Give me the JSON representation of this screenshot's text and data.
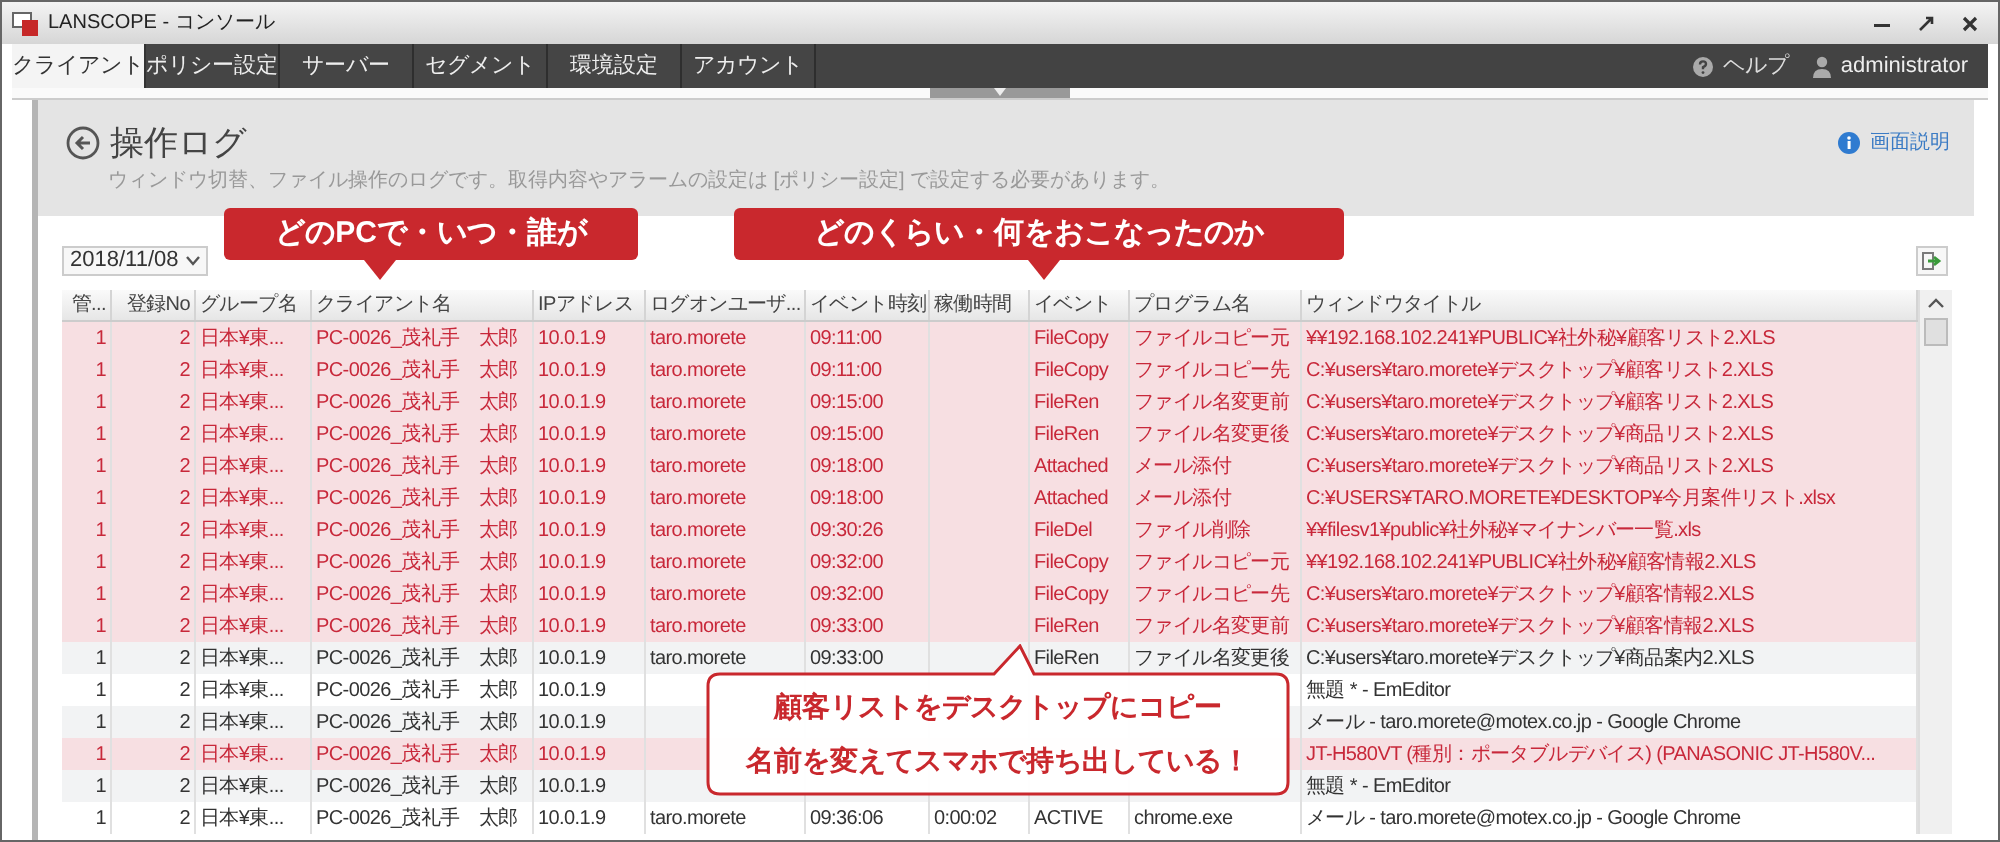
{
  "window": {
    "title": "LANSCOPE - コンソール"
  },
  "tabs": [
    {
      "label": "クライアント",
      "selected": true
    },
    {
      "label": "ポリシー設定",
      "selected": false
    },
    {
      "label": "サーバー",
      "selected": false
    },
    {
      "label": "セグメント",
      "selected": false
    },
    {
      "label": "環境設定",
      "selected": false
    },
    {
      "label": "アカウント",
      "selected": false
    }
  ],
  "header_links": {
    "help": "ヘルプ",
    "user": "administrator"
  },
  "page": {
    "title": "操作ログ",
    "description": "ウィンドウ切替、ファイル操作のログです。取得内容やアラームの設定は [ポリシー設定] で設定する必要があります。",
    "help_link": "画面説明"
  },
  "callouts": [
    {
      "text": "どのPCで・いつ・誰が"
    },
    {
      "text": "どのくらい・何をおこなったのか"
    }
  ],
  "note": {
    "lines": [
      "顧客リストをデスクトップにコピー",
      "名前を変えてスマホで持ち出している！"
    ]
  },
  "date_filter": {
    "value": "2018/11/08"
  },
  "table": {
    "columns": [
      "管...",
      "登録No",
      "グループ名",
      "クライアント名",
      "IPアドレス",
      "ログオンユーザ...",
      "イベント時刻",
      "稼働時間",
      "イベント",
      "プログラム名",
      "ウィンドウタイトル"
    ],
    "rows": [
      {
        "alarm": true,
        "cells": [
          "1",
          "2",
          "日本¥東...",
          "PC-0026_茂礼手　太郎",
          "10.0.1.9",
          "taro.morete",
          "09:11:00",
          null,
          "FileCopy",
          "ファイルコピー元",
          "¥¥192.168.102.241¥PUBLIC¥社外秘¥顧客リスト2.XLS"
        ]
      },
      {
        "alarm": true,
        "cells": [
          "1",
          "2",
          "日本¥東...",
          "PC-0026_茂礼手　太郎",
          "10.0.1.9",
          "taro.morete",
          "09:11:00",
          null,
          "FileCopy",
          "ファイルコピー先",
          "C:¥users¥taro.morete¥デスクトップ¥顧客リスト2.XLS"
        ]
      },
      {
        "alarm": true,
        "cells": [
          "1",
          "2",
          "日本¥東...",
          "PC-0026_茂礼手　太郎",
          "10.0.1.9",
          "taro.morete",
          "09:15:00",
          null,
          "FileRen",
          "ファイル名変更前",
          "C:¥users¥taro.morete¥デスクトップ¥顧客リスト2.XLS"
        ]
      },
      {
        "alarm": true,
        "cells": [
          "1",
          "2",
          "日本¥東...",
          "PC-0026_茂礼手　太郎",
          "10.0.1.9",
          "taro.morete",
          "09:15:00",
          null,
          "FileRen",
          "ファイル名変更後",
          "C:¥users¥taro.morete¥デスクトップ¥商品リスト2.XLS"
        ]
      },
      {
        "alarm": true,
        "cells": [
          "1",
          "2",
          "日本¥東...",
          "PC-0026_茂礼手　太郎",
          "10.0.1.9",
          "taro.morete",
          "09:18:00",
          null,
          "Attached",
          "メール添付",
          "C:¥users¥taro.morete¥デスクトップ¥商品リスト2.XLS"
        ]
      },
      {
        "alarm": true,
        "cells": [
          "1",
          "2",
          "日本¥東...",
          "PC-0026_茂礼手　太郎",
          "10.0.1.9",
          "taro.morete",
          "09:18:00",
          null,
          "Attached",
          "メール添付",
          "C:¥USERS¥TARO.MORETE¥DESKTOP¥今月案件リスト.xlsx"
        ]
      },
      {
        "alarm": true,
        "cells": [
          "1",
          "2",
          "日本¥東...",
          "PC-0026_茂礼手　太郎",
          "10.0.1.9",
          "taro.morete",
          "09:30:26",
          null,
          "FileDel",
          "ファイル削除",
          "¥¥filesv1¥public¥社外秘¥マイナンバー一覧.xls"
        ]
      },
      {
        "alarm": true,
        "cells": [
          "1",
          "2",
          "日本¥東...",
          "PC-0026_茂礼手　太郎",
          "10.0.1.9",
          "taro.morete",
          "09:32:00",
          null,
          "FileCopy",
          "ファイルコピー元",
          "¥¥192.168.102.241¥PUBLIC¥社外秘¥顧客情報2.XLS"
        ]
      },
      {
        "alarm": true,
        "cells": [
          "1",
          "2",
          "日本¥東...",
          "PC-0026_茂礼手　太郎",
          "10.0.1.9",
          "taro.morete",
          "09:32:00",
          null,
          "FileCopy",
          "ファイルコピー先",
          "C:¥users¥taro.morete¥デスクトップ¥顧客情報2.XLS"
        ]
      },
      {
        "alarm": true,
        "cells": [
          "1",
          "2",
          "日本¥東...",
          "PC-0026_茂礼手　太郎",
          "10.0.1.9",
          "taro.morete",
          "09:33:00",
          null,
          "FileRen",
          "ファイル名変更前",
          "C:¥users¥taro.morete¥デスクトップ¥顧客情報2.XLS"
        ]
      },
      {
        "alarm": false,
        "cells": [
          "1",
          "2",
          "日本¥東...",
          "PC-0026_茂礼手　太郎",
          "10.0.1.9",
          "taro.morete",
          "09:33:00",
          null,
          "FileRen",
          "ファイル名変更後",
          "C:¥users¥taro.morete¥デスクトップ¥商品案内2.XLS"
        ]
      },
      {
        "alarm": false,
        "cells": [
          "1",
          "2",
          "日本¥東...",
          "PC-0026_茂礼手　太郎",
          "10.0.1.9",
          null,
          null,
          null,
          null,
          null,
          "無題 * - EmEditor"
        ]
      },
      {
        "alarm": false,
        "cells": [
          "1",
          "2",
          "日本¥東...",
          "PC-0026_茂礼手　太郎",
          "10.0.1.9",
          null,
          null,
          null,
          null,
          null,
          "メール - taro.morete@motex.co.jp - Google Chrome"
        ]
      },
      {
        "alarm": true,
        "cells": [
          "1",
          "2",
          "日本¥東...",
          "PC-0026_茂礼手　太郎",
          "10.0.1.9",
          null,
          null,
          null,
          null,
          null,
          "JT-H580VT (種別：ポータブルデバイス) (PANASONIC JT-H580V..."
        ]
      },
      {
        "alarm": false,
        "cells": [
          "1",
          "2",
          "日本¥東...",
          "PC-0026_茂礼手　太郎",
          "10.0.1.9",
          null,
          null,
          null,
          null,
          null,
          "無題 * - EmEditor"
        ]
      },
      {
        "alarm": false,
        "cells": [
          "1",
          "2",
          "日本¥東...",
          "PC-0026_茂礼手　太郎",
          "10.0.1.9",
          "taro.morete",
          "09:36:06",
          "0:00:02",
          "ACTIVE",
          "chrome.exe",
          "メール - taro.morete@motex.co.jp - Google Chrome"
        ]
      }
    ]
  }
}
